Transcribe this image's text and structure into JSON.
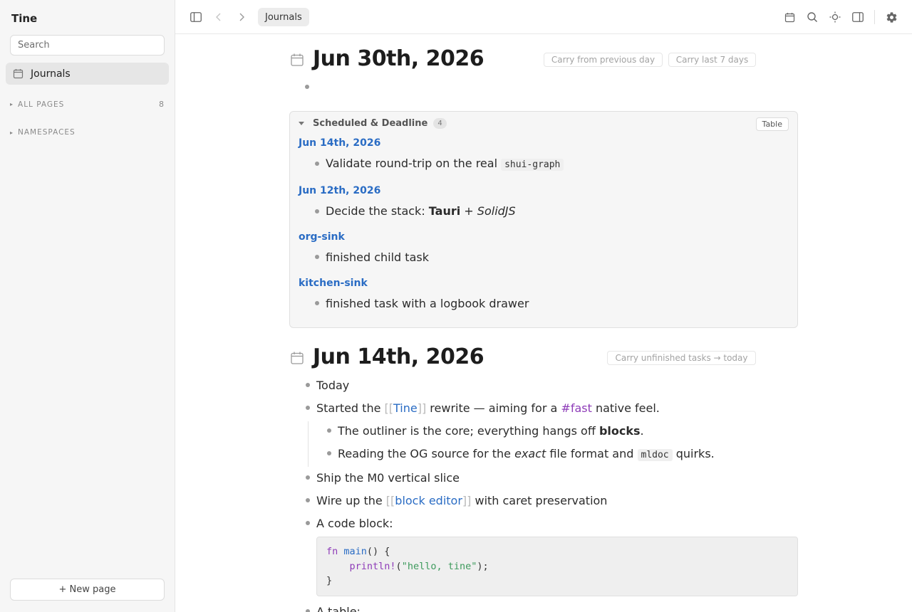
{
  "app": {
    "title": "Tine"
  },
  "sidebar": {
    "search_placeholder": "Search",
    "journals_label": "Journals",
    "all_pages": {
      "label": "ALL PAGES",
      "count": "8"
    },
    "namespaces": {
      "label": "NAMESPACES"
    },
    "new_page_label": "+ New page"
  },
  "toolbar": {
    "breadcrumb": "Journals",
    "icons": [
      "sidebar-toggle-icon",
      "back-icon",
      "forward-icon",
      "calendar-icon",
      "search-icon",
      "theme-icon",
      "right-panel-icon",
      "settings-icon"
    ]
  },
  "today": {
    "title": "Jun 30th, 2026",
    "carry_prev": "Carry from previous day",
    "carry_7": "Carry last 7 days"
  },
  "scheduled": {
    "title": "Scheduled & Deadline",
    "count": "4",
    "view_button": "Table",
    "groups": [
      {
        "page": "Jun 14th, 2026",
        "task": "Validate round-trip on the real",
        "code": "shui-graph"
      },
      {
        "page": "Jun 12th, 2026",
        "task_prefix": "Decide the stack: ",
        "bold": "Tauri",
        "plus": " + ",
        "italic": "SolidJS"
      },
      {
        "page": "org-sink",
        "task": "finished child task"
      },
      {
        "page": "kitchen-sink",
        "task": "finished task with a logbook drawer"
      }
    ]
  },
  "journal2": {
    "title": "Jun 14th, 2026",
    "carry_btn": "Carry unfinished tasks → today",
    "blocks": {
      "today": "Today",
      "started": {
        "pre": "Started the ",
        "open": "[[",
        "link": "Tine",
        "close": "]]",
        "mid": " rewrite — aiming for a ",
        "tag": "#fast",
        "post": " native feel."
      },
      "outliner": {
        "pre": "The outliner is the core; everything hangs off ",
        "bold": "blocks",
        "post": "."
      },
      "reading": {
        "pre": "Reading the OG source for the ",
        "italic": "exact",
        "mid": " file format and ",
        "code": "mldoc",
        "post": " quirks."
      },
      "ship": "Ship the M0 vertical slice",
      "wire": {
        "pre": "Wire up the ",
        "open": "[[",
        "link": "block editor",
        "close": "]]",
        "post": " with caret preservation"
      },
      "code_label": "A code block:",
      "code": {
        "line1_kw": "fn",
        "line1_fn": "main",
        "line1_rest": "() {",
        "line2_macro": "println!",
        "line2_open": "(",
        "line2_str": "\"hello, tine\"",
        "line2_close": ");",
        "line3": "}"
      },
      "table_label": "A table:"
    }
  },
  "colors": {
    "link": "#2a6cc4",
    "tag": "#8e3cb8",
    "string": "#3d9a5c"
  }
}
